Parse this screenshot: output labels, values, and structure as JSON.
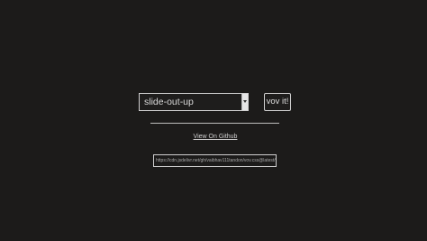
{
  "animation_select": {
    "selected": "slide-out-up"
  },
  "run_button": {
    "label": "vov it!"
  },
  "github_link": {
    "label": "View On Github"
  },
  "share_url": {
    "value": "https://cdn.jsdelivr.net/gh/vaibhav111tandon/vov.css@latest/vov.css"
  },
  "colors": {
    "background": "#1c1b1a",
    "border": "#cfcfcf",
    "text": "#d8d8d8"
  }
}
